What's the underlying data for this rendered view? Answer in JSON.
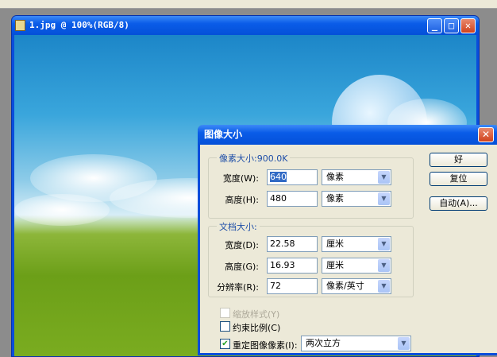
{
  "document": {
    "title": "1.jpg @ 100%(RGB/8)"
  },
  "dialog": {
    "title": "图像大小",
    "pixel_group": {
      "label": "像素大小:900.0K",
      "width": {
        "label": "宽度(W):",
        "value": "640",
        "unit": "像素"
      },
      "height": {
        "label": "高度(H):",
        "value": "480",
        "unit": "像素"
      }
    },
    "doc_group": {
      "label": "文档大小:",
      "width": {
        "label": "宽度(D):",
        "value": "22.58",
        "unit": "厘米"
      },
      "height": {
        "label": "高度(G):",
        "value": "16.93",
        "unit": "厘米"
      },
      "resolution": {
        "label": "分辨率(R):",
        "value": "72",
        "unit": "像素/英寸"
      }
    },
    "buttons": {
      "ok": "好",
      "reset": "复位",
      "auto": "自动(A)..."
    },
    "scale_styles": {
      "label": "缩放样式(Y)",
      "checked": false,
      "disabled": true
    },
    "constrain": {
      "label": "约束比例(C)",
      "checked": false
    },
    "resample": {
      "label": "重定图像像素(I):",
      "checked": true,
      "method": "两次立方"
    }
  }
}
